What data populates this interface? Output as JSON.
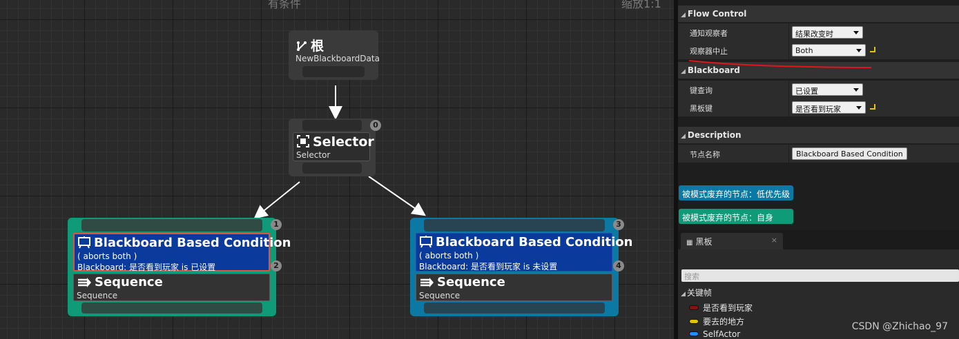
{
  "graph": {
    "zoom_label": "缩放1:1",
    "top_partial_label": "有条件",
    "root": {
      "title": "根",
      "subtitle": "NewBlackboardData"
    },
    "selector": {
      "title": "Selector",
      "subtitle": "Selector",
      "index": "0"
    },
    "left_branch": {
      "index_top": "1",
      "index_deco": "2",
      "decorator_title": "Blackboard Based Condition",
      "decorator_line1": "( aborts both )",
      "decorator_line2": "Blackboard: 是否看到玩家 is 已设置",
      "sequence_title": "Sequence",
      "sequence_subtitle": "Sequence"
    },
    "right_branch": {
      "index_top": "3",
      "index_deco": "4",
      "decorator_title": "Blackboard Based Condition",
      "decorator_line1": "( aborts both )",
      "decorator_line2": "Blackboard: 是否看到玩家 is 未设置",
      "sequence_title": "Sequence",
      "sequence_subtitle": "Sequence"
    },
    "colors": {
      "branch_self": "#0f9a78",
      "branch_lower_priority": "#0b79a3",
      "decorator": "#0a3a9c",
      "selected_outline": "#e0543c"
    }
  },
  "details": {
    "flow_control": {
      "header": "Flow Control",
      "notify_observer_label": "通知观察者",
      "notify_observer_value": "结果改变时",
      "observer_aborts_label": "观察器中止",
      "observer_aborts_value": "Both"
    },
    "blackboard": {
      "header": "Blackboard",
      "key_query_label": "键查询",
      "key_query_value": "已设置",
      "blackboard_key_label": "黑板键",
      "blackboard_key_value": "是否看到玩家"
    },
    "description": {
      "header": "Description",
      "node_name_label": "节点名称",
      "node_name_value": "Blackboard Based Condition"
    },
    "legend": {
      "lower_priority": "被模式废弃的节点：低优先级",
      "self": "被模式废弃的节点：自身"
    }
  },
  "blackboard_panel": {
    "tab_label": "黑板",
    "tab_close": "×",
    "search_placeholder": "搜索",
    "section_header": "关键帧",
    "keys": [
      {
        "name": "是否看到玩家",
        "color": "#8b1010"
      },
      {
        "name": "要去的地方",
        "color": "#e0c400"
      },
      {
        "name": "SelfActor",
        "color": "#1e90ff"
      }
    ]
  },
  "watermark": "CSDN @Zhichao_97"
}
